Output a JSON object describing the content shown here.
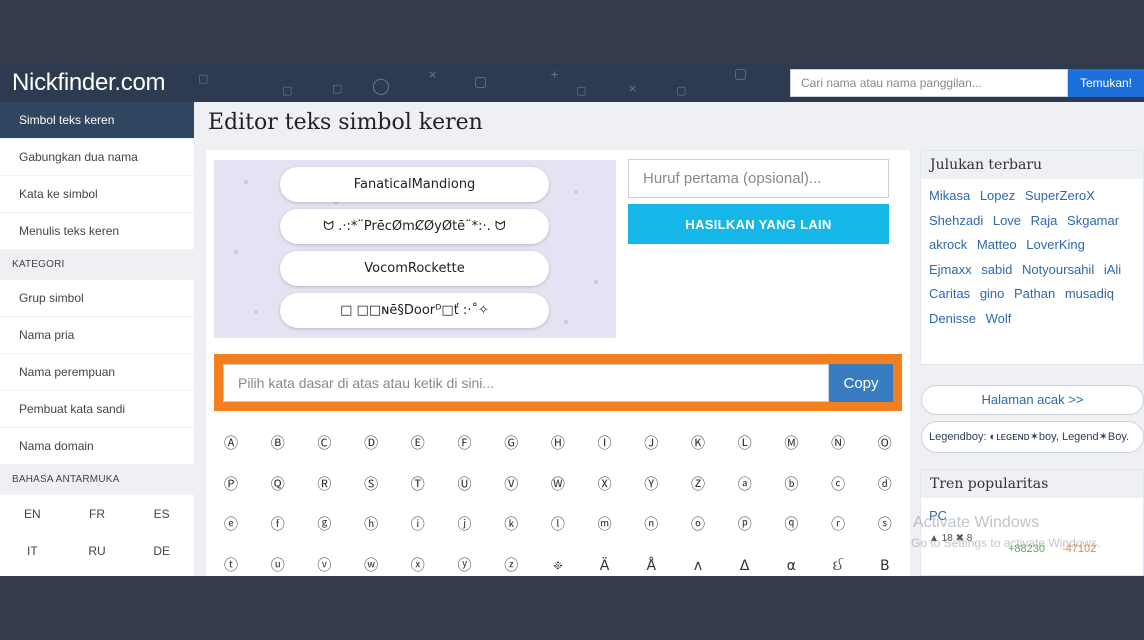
{
  "header": {
    "logo": "Nickfinder.com",
    "search_placeholder": "Cari nama atau nama panggilan...",
    "search_button": "Temukan!"
  },
  "sidebar": {
    "items": [
      "Simbol teks keren",
      "Gabungkan dua nama",
      "Kata ke simbol",
      "Menulis teks keren"
    ],
    "category_label": "KATEGORI",
    "category_items": [
      "Grup simbol",
      "Nama pria",
      "Nama perempuan",
      "Pembuat kata sandi",
      "Nama domain"
    ],
    "language_label": "BAHASA ANTARMUKA",
    "languages": [
      "EN",
      "FR",
      "ES",
      "IT",
      "RU",
      "DE"
    ]
  },
  "main": {
    "title": "Editor teks simbol keren",
    "generated_nicks": [
      "FanaticalMandiong",
      "ᗢ .·:*¨PrēcØmȻØyØtē¨*:·. ᗢ",
      "VocomRockette",
      "□ □□ɴē§Doorᴰ□ť :·˚✧"
    ],
    "first_letter_placeholder": "Huruf pertama (opsional)...",
    "generate_button": "HASILKAN YANG LAIN",
    "copy_placeholder": "Pilih kata dasar di atas atau ketik di sini...",
    "copy_button": "Copy",
    "symbols": [
      "Ⓐ",
      "Ⓑ",
      "Ⓒ",
      "Ⓓ",
      "Ⓔ",
      "Ⓕ",
      "Ⓖ",
      "Ⓗ",
      "Ⓘ",
      "Ⓙ",
      "Ⓚ",
      "Ⓛ",
      "Ⓜ",
      "Ⓝ",
      "Ⓞ",
      "Ⓟ",
      "Ⓠ",
      "Ⓡ",
      "Ⓢ",
      "Ⓣ",
      "Ⓤ",
      "Ⓥ",
      "Ⓦ",
      "Ⓧ",
      "Ⓨ",
      "Ⓩ",
      "ⓐ",
      "ⓑ",
      "ⓒ",
      "ⓓ",
      "ⓔ",
      "ⓕ",
      "ⓖ",
      "ⓗ",
      "ⓘ",
      "ⓙ",
      "ⓚ",
      "ⓛ",
      "ⓜ",
      "ⓝ",
      "ⓞ",
      "ⓟ",
      "ⓠ",
      "ⓡ",
      "ⓢ",
      "ⓣ",
      "ⓤ",
      "ⓥ",
      "ⓦ",
      "ⓧ",
      "ⓨ",
      "ⓩ",
      "፠",
      "Ä",
      "Å",
      "ʌ",
      "Δ",
      "α",
      "ઈ",
      "Β"
    ]
  },
  "right": {
    "recent_title": "Julukan terbaru",
    "recent_nicks": [
      "Mikasa",
      "Lopez",
      "SuperZeroX",
      "Shehzadi",
      "Love",
      "Raja",
      "Skgamar",
      "akrock",
      "Matteo",
      "LoverKing",
      "Ejmaxx",
      "sabid",
      "Notyoursahil",
      "iAli",
      "Caritas",
      "gino",
      "Pathan",
      "musadiq",
      "Denisse",
      "Wolf"
    ],
    "random_button": "Halaman acak >>",
    "legend_text": "Legendboy: ◐ʟᴇɢᴇɴᴅ✶boy, Legend✶Boy.",
    "trend_title": "Tren popularitas",
    "trend_item": "PC",
    "trend_meta": "▲ 18  ✖ 8",
    "trend_up": "+88230",
    "trend_down": "-47102"
  },
  "watermark": {
    "line1": "Activate Windows",
    "line2": "Go to Settings to activate Windows."
  }
}
